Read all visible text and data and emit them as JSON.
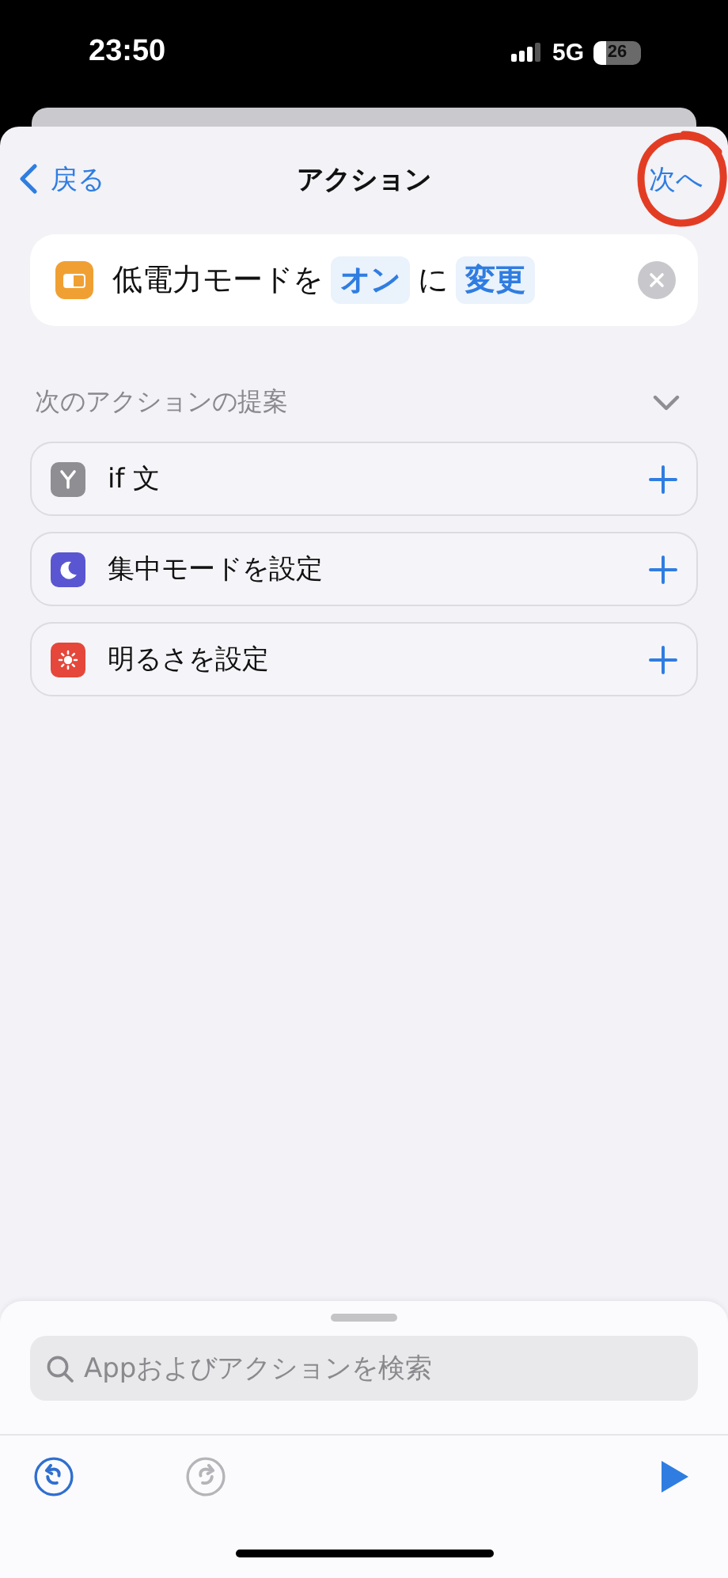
{
  "status_bar": {
    "time": "23:50",
    "network": "5G",
    "battery": "26"
  },
  "nav": {
    "back": "戻る",
    "title": "アクション",
    "next": {
      "label": "次へ",
      "circled": true
    }
  },
  "action": {
    "color": "#f0a033",
    "parts": [
      {
        "kind": "text",
        "text": "低電力モードを"
      },
      {
        "kind": "token",
        "text": "オン"
      },
      {
        "kind": "text",
        "text": "に"
      },
      {
        "kind": "token",
        "text": "変更"
      }
    ]
  },
  "suggestions": {
    "title": "次のアクションの提案",
    "expanded": true,
    "items": [
      {
        "kind": "branch",
        "label": "if 文",
        "color": "#8e8e93"
      },
      {
        "kind": "moon",
        "label": "集中モードを設定",
        "color": "#5a56d2"
      },
      {
        "kind": "sun",
        "label": "明るさを設定",
        "color": "#e5473a"
      }
    ]
  },
  "search": {
    "placeholder": "Appおよびアクションを検索"
  },
  "toolbar": {
    "undo": {
      "disabled": false
    },
    "redo": {
      "disabled": true
    }
  }
}
